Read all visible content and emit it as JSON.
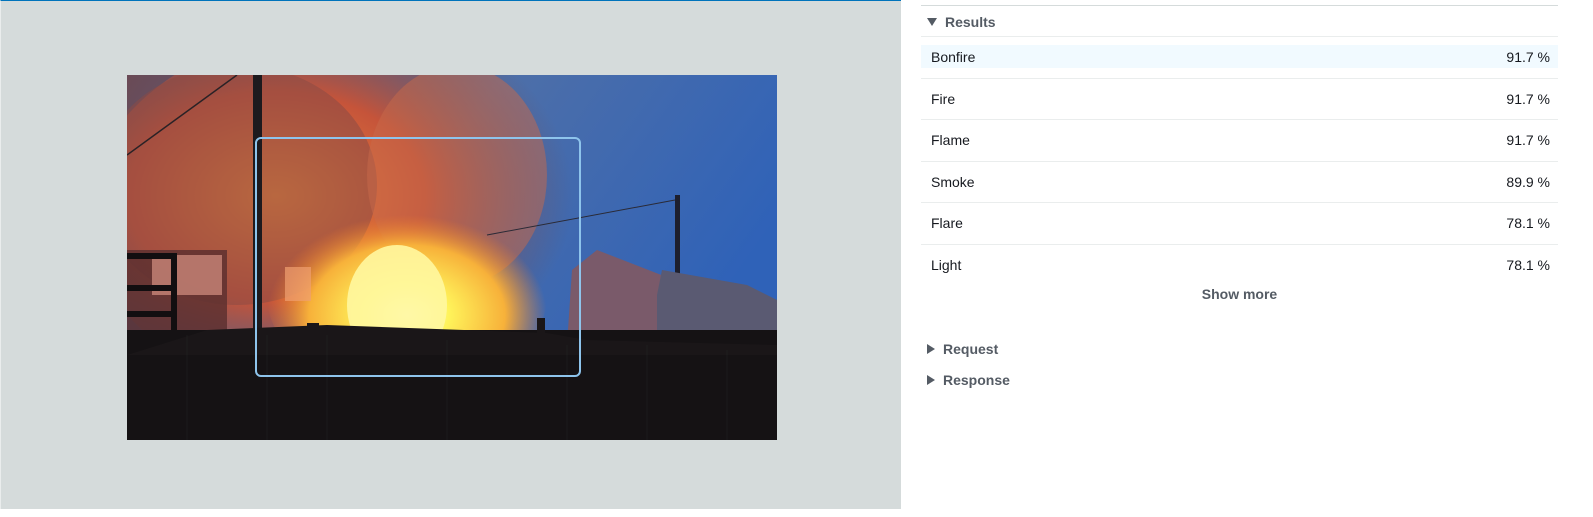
{
  "results": {
    "title": "Results",
    "items": [
      {
        "label": "Bonfire",
        "confidence": "91.7 %"
      },
      {
        "label": "Fire",
        "confidence": "91.7 %"
      },
      {
        "label": "Flame",
        "confidence": "91.7 %"
      },
      {
        "label": "Smoke",
        "confidence": "89.9 %"
      },
      {
        "label": "Flare",
        "confidence": "78.1 %"
      },
      {
        "label": "Light",
        "confidence": "78.1 %"
      }
    ],
    "show_more_label": "Show more"
  },
  "request": {
    "title": "Request"
  },
  "response": {
    "title": "Response"
  },
  "colors": {
    "panel_background": "#d5dbdb",
    "bounding_box": "#8ec4ec",
    "highlight_row": "#f1faff",
    "header_text": "#545b64"
  }
}
